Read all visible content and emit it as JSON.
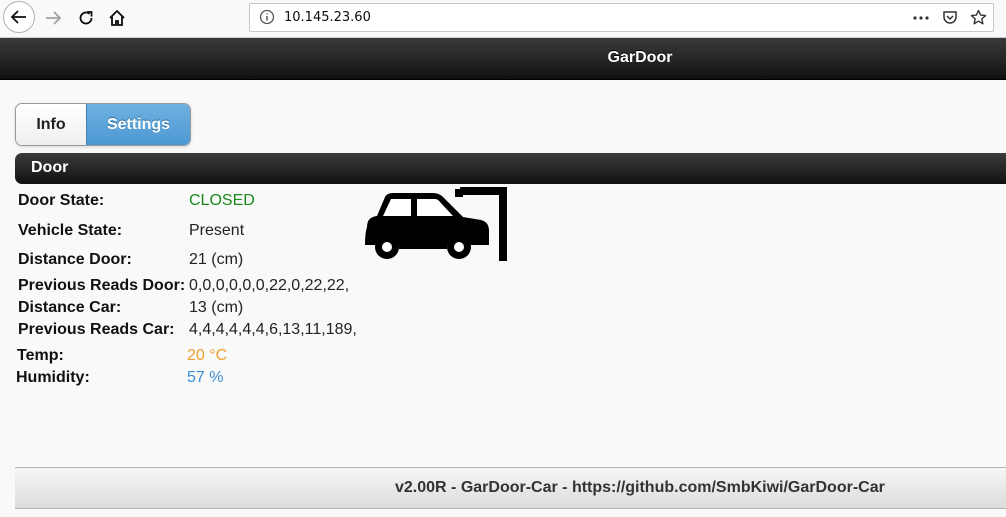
{
  "browser": {
    "url": "10.145.23.60"
  },
  "header": {
    "title": "GarDoor"
  },
  "tabs": [
    {
      "label": "Info",
      "active": false
    },
    {
      "label": "Settings",
      "active": true
    }
  ],
  "section": {
    "title": "Door"
  },
  "fields": {
    "door_state": {
      "label": "Door State:",
      "value": "CLOSED",
      "color": "#1a8a1a"
    },
    "vehicle_state": {
      "label": "Vehicle State:",
      "value": "Present"
    },
    "distance_door": {
      "label": "Distance Door:",
      "value": "21 (cm)"
    },
    "prev_reads_door": {
      "label": "Previous Reads Door:",
      "value": "0,0,0,0,0,0,22,0,22,22,"
    },
    "distance_car": {
      "label": "Distance Car:",
      "value": "13 (cm)"
    },
    "prev_reads_car": {
      "label": "Previous Reads Car:",
      "value": "4,4,4,4,4,4,6,13,11,189,"
    },
    "temp": {
      "label": "Temp:",
      "value": "20 °C",
      "color": "#f0a030"
    },
    "humidity": {
      "label": "Humidity:",
      "value": "57 %",
      "color": "#3a8fd6"
    }
  },
  "icons": {
    "vehicle": "car-in-garage-icon"
  },
  "footer": {
    "text": "v2.00R - GarDoor-Car - https://github.com/SmbKiwi/GarDoor-Car"
  }
}
